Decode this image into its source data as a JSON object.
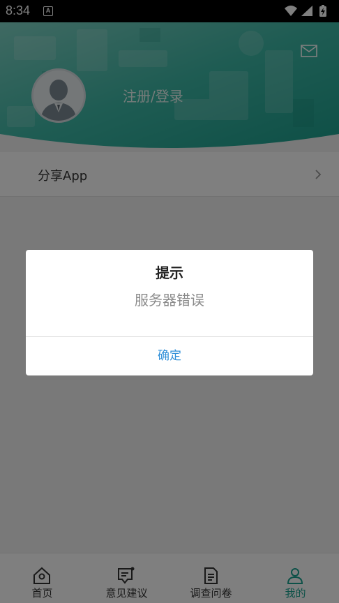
{
  "status_bar": {
    "time": "8:34",
    "app_icon_letter": "A"
  },
  "header": {
    "login_text": "注册/登录",
    "accent_color": "#1aa391"
  },
  "menu": {
    "items": [
      {
        "label": "分享App"
      }
    ]
  },
  "tabbar": {
    "tabs": [
      {
        "label": "首页",
        "icon": "home-icon",
        "active": false
      },
      {
        "label": "意见建议",
        "icon": "feedback-icon",
        "active": false
      },
      {
        "label": "调查问卷",
        "icon": "document-icon",
        "active": false
      },
      {
        "label": "我的",
        "icon": "user-icon",
        "active": true
      }
    ]
  },
  "dialog": {
    "title": "提示",
    "message": "服务器错误",
    "confirm_label": "确定",
    "confirm_color": "#2f8fd8"
  }
}
